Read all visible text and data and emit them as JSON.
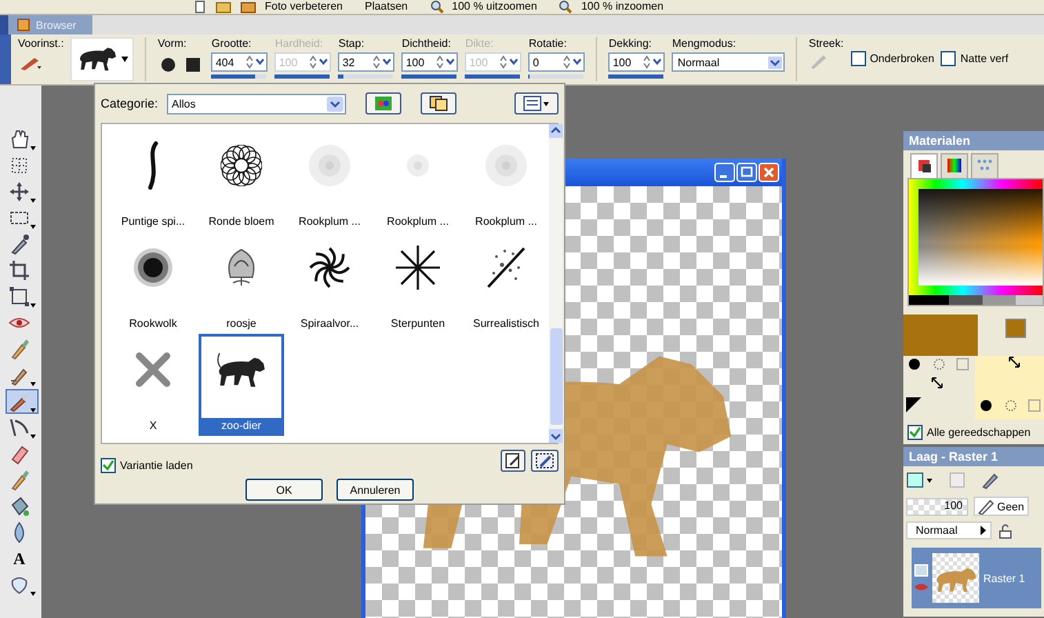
{
  "toolbar": {
    "labels": [
      "Foto verbeteren",
      "Plaatsen",
      "100 % uitzoomen",
      "100 % inzoomen"
    ]
  },
  "browser_tab": {
    "label": "Browser"
  },
  "tool_options": {
    "preset_label": "Voorinst.:",
    "shape_label": "Vorm:",
    "fields": [
      {
        "label": "Grootte:",
        "value": "404",
        "disabled": false,
        "level": 0.8
      },
      {
        "label": "Hardheid:",
        "value": "100",
        "disabled": true,
        "level": 1
      },
      {
        "label": "Stap:",
        "value": "32",
        "disabled": false,
        "level": 0.1
      },
      {
        "label": "Dichtheid:",
        "value": "100",
        "disabled": false,
        "level": 1
      },
      {
        "label": "Dikte:",
        "value": "100",
        "disabled": true,
        "level": 1
      },
      {
        "label": "Rotatie:",
        "value": "0",
        "disabled": false,
        "level": 0.02
      },
      {
        "label": "Dekking:",
        "value": "100",
        "disabled": false,
        "level": 1
      }
    ],
    "blend": {
      "label": "Mengmodus:",
      "value": "Normaal"
    },
    "stroke_label": "Streek:",
    "checkboxes": [
      {
        "label": "Onderbroken",
        "checked": false
      },
      {
        "label": "Natte verf",
        "checked": false
      }
    ]
  },
  "tools": [
    {
      "kind": "hand",
      "selected": false,
      "flyout": true
    },
    {
      "kind": "grid",
      "selected": false,
      "flyout": false
    },
    {
      "kind": "move",
      "selected": false,
      "flyout": true
    },
    {
      "kind": "selection",
      "selected": false,
      "flyout": true
    },
    {
      "kind": "dropper",
      "selected": false,
      "flyout": false
    },
    {
      "kind": "crop",
      "selected": false,
      "flyout": false
    },
    {
      "kind": "transform",
      "selected": false,
      "flyout": true
    },
    {
      "kind": "eye",
      "selected": false,
      "flyout": false
    },
    {
      "kind": "retouch",
      "selected": false,
      "flyout": false
    },
    {
      "kind": "clone",
      "selected": false,
      "flyout": true
    },
    {
      "kind": "brush",
      "selected": true,
      "flyout": true
    },
    {
      "kind": "warp",
      "selected": false,
      "flyout": true
    },
    {
      "kind": "eraser",
      "selected": false,
      "flyout": false
    },
    {
      "kind": "retouch",
      "selected": false,
      "flyout": false
    },
    {
      "kind": "fill",
      "selected": false,
      "flyout": false
    },
    {
      "kind": "drop",
      "selected": false,
      "flyout": false
    },
    {
      "kind": "text",
      "glyph": "A",
      "selected": false,
      "flyout": false
    },
    {
      "kind": "shape",
      "selected": false,
      "flyout": true
    }
  ],
  "brush_dialog": {
    "category_label": "Categorie:",
    "category": "Allos",
    "brushes": [
      {
        "kind": "stroke",
        "label": "Puntige spi...",
        "selected": false
      },
      {
        "kind": "flower",
        "label": "Ronde bloem",
        "selected": false
      },
      {
        "kind": "smoke",
        "label": "Rookplum ...",
        "selected": false
      },
      {
        "kind": "smoke-small",
        "label": "Rookplum ...",
        "selected": false
      },
      {
        "kind": "smoke",
        "label": "Rookplum ...",
        "selected": false
      },
      {
        "kind": "cloud",
        "label": "Rookwolk",
        "selected": false
      },
      {
        "kind": "rose",
        "label": "roosje",
        "selected": false
      },
      {
        "kind": "spiral",
        "label": "Spiraalvor...",
        "selected": false
      },
      {
        "kind": "star",
        "label": "Sterpunten",
        "selected": false
      },
      {
        "kind": "burst",
        "label": "Surrealistisch",
        "selected": false
      },
      {
        "kind": "cross",
        "label": "X",
        "selected": false
      },
      {
        "kind": "animal",
        "label": "zoo-dier",
        "selected": true
      }
    ],
    "variant": {
      "label": "Variantie laden",
      "checked": true
    },
    "buttons": [
      "OK",
      "Annuleren"
    ]
  },
  "materials": {
    "title": "Materialen",
    "tabs": [
      {
        "selected": true
      },
      {
        "selected": false
      },
      {
        "selected": false
      }
    ],
    "swatches": [
      {
        "color": "#a8720e"
      },
      {
        "color": "#a8720e"
      },
      {
        "color": "#fdf0b8"
      }
    ],
    "all_tools": {
      "label": "Alle gereedschappen",
      "checked": true
    }
  },
  "layers": {
    "title": "Laag - Raster 1",
    "opacity": "100",
    "mask": "Geen",
    "blend_mode": "Normaal",
    "rows": [
      {
        "name": "Raster 1",
        "selected": true
      }
    ]
  }
}
